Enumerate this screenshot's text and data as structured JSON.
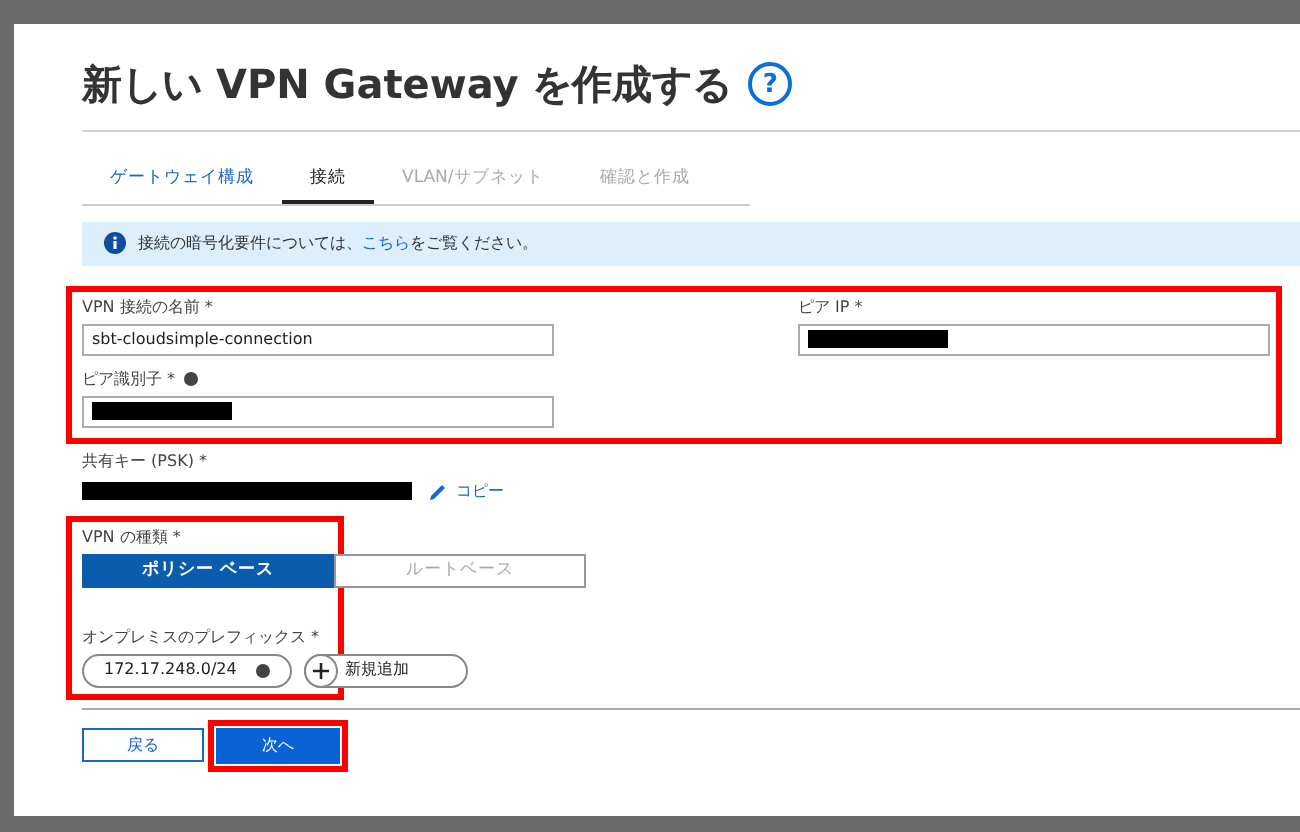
{
  "dialog": {
    "title": "新しい VPN Gateway を作成する",
    "help_icon": "?"
  },
  "tabs": [
    {
      "label": "ゲートウェイ構成",
      "selected": false,
      "disabled": false
    },
    {
      "label": "接続",
      "selected": true,
      "disabled": false
    },
    {
      "label": "VLAN/サブネット",
      "selected": false,
      "disabled": true
    },
    {
      "label": "確認と作成",
      "selected": false,
      "disabled": true
    }
  ],
  "info": {
    "before": "接続の暗号化要件については、",
    "link": "こちら",
    "after": "をご覧ください。"
  },
  "fields": {
    "name": {
      "label": "VPN 接続の名前 *",
      "value": "sbt-cloudsimple-connection"
    },
    "peer_ip": {
      "label": "ピア IP *"
    },
    "peer_id": {
      "label": "ピア識別子 *"
    },
    "psk": {
      "label": "共有キー (PSK) *",
      "copy": "コピー"
    }
  },
  "vpn_type": {
    "label": "VPN の種類 *",
    "options": [
      {
        "label": "ポリシー ベース",
        "selected": true
      },
      {
        "label": "ルートベース",
        "selected": false
      }
    ]
  },
  "prefixes": {
    "label": "オンプレミスのプレフィックス *",
    "items": [
      "172.17.248.0/24"
    ],
    "add": "新規追加"
  },
  "buttons": {
    "back": "戻る",
    "next": "次へ"
  }
}
